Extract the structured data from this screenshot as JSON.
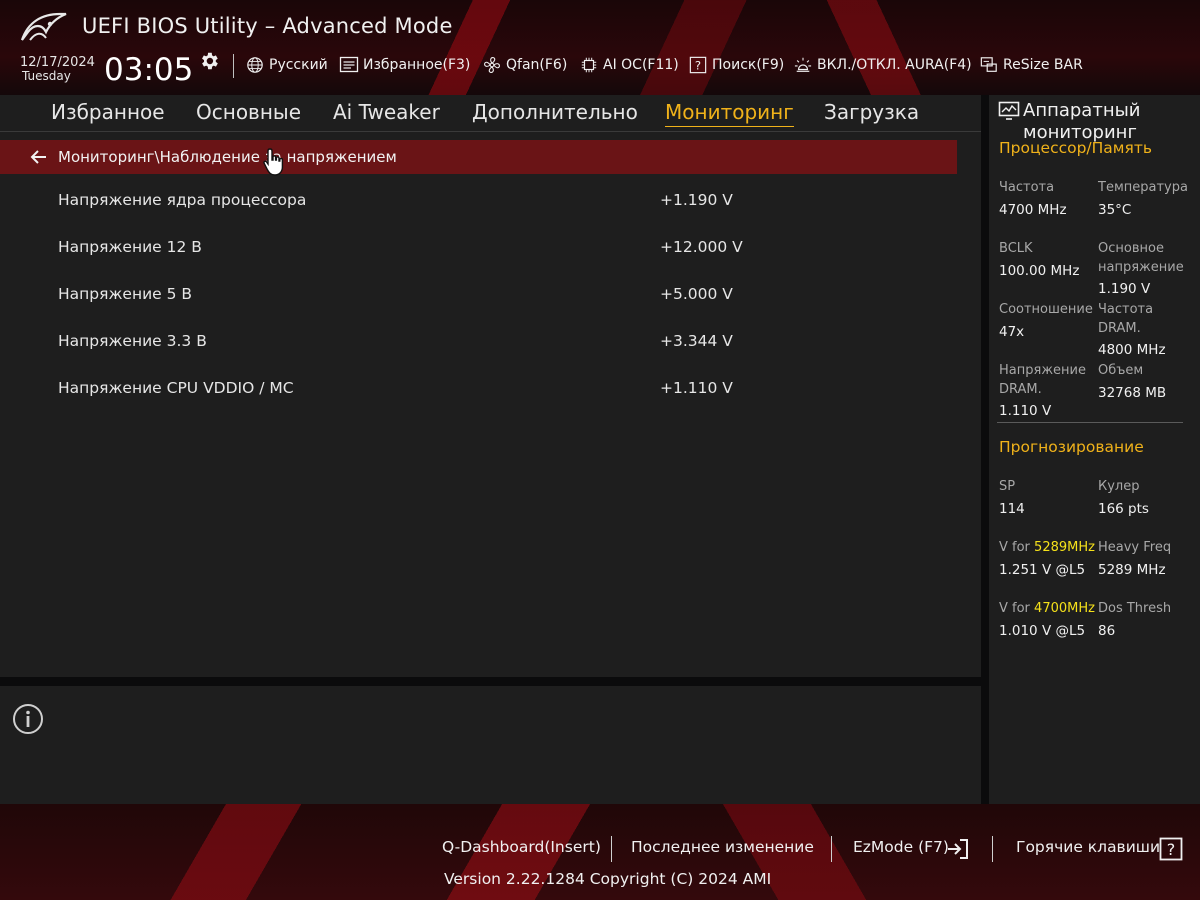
{
  "header": {
    "title": "UEFI BIOS Utility – Advanced Mode",
    "date": "12/17/2024",
    "weekday": "Tuesday",
    "time": "03:05",
    "tools": {
      "language": "Русский",
      "favorites": "Избранное(F3)",
      "qfan": "Qfan(F6)",
      "aioc": "AI OC(F11)",
      "search": "Поиск(F9)",
      "aura": "ВКЛ./ОТКЛ. AURA(F4)",
      "resizebar": "ReSize BAR"
    }
  },
  "tabs": {
    "favorites": "Избранное",
    "main": "Основные",
    "ai_tweaker": "Ai Tweaker",
    "advanced": "Дополнительно",
    "monitor": "Мониторинг",
    "boot": "Загрузка"
  },
  "breadcrumb": "Мониторинг\\Наблюдение за напряжением",
  "voltages": [
    {
      "label": "Напряжение ядра процессора",
      "value": "+1.190 V"
    },
    {
      "label": "Напряжение 12 В",
      "value": "+12.000 V"
    },
    {
      "label": "Напряжение 5 В",
      "value": "+5.000 V"
    },
    {
      "label": "Напряжение 3.3 В",
      "value": "+3.344 V"
    },
    {
      "label": "Напряжение CPU VDDIO / MC",
      "value": "+1.110 V"
    }
  ],
  "hw_monitor": {
    "title": "Аппаратный мониторинг",
    "cpu_mem": {
      "heading": "Процессор/Память",
      "frequency_label": "Частота",
      "frequency_value": "4700 MHz",
      "temperature_label": "Температура",
      "temperature_value": "35°C",
      "bclk_label": "BCLK",
      "bclk_value": "100.00 MHz",
      "core_voltage_label": "Основное напряжение",
      "core_voltage_value": "1.190 V",
      "ratio_label": "Соотношение",
      "ratio_value": "47x",
      "dram_freq_label": "Частота DRAM.",
      "dram_freq_value": "4800 MHz",
      "dram_voltage_label": "Напряжение DRAM.",
      "dram_voltage_value": "1.110 V",
      "capacity_label": "Объем",
      "capacity_value": "32768 MB"
    },
    "prediction": {
      "heading": "Прогнозирование",
      "sp_label": "SP",
      "sp_value": "114",
      "cooler_label": "Кулер",
      "cooler_value": "166 pts",
      "v_for_label": "V for",
      "v1_freq": "5289MHz",
      "v1_value": "1.251 V @L5",
      "heavy_freq_label": "Heavy Freq",
      "heavy_freq_value": "5289 MHz",
      "v2_freq": "4700MHz",
      "v2_value": "1.010 V @L5",
      "dos_thresh_label": "Dos Thresh",
      "dos_thresh_value": "86"
    }
  },
  "footer": {
    "qdashboard": "Q-Dashboard(Insert)",
    "last_modified": "Последнее изменение",
    "ezmode": "EzMode (F7)",
    "hotkeys": "Горячие клавиши",
    "version": "Version 2.22.1284 Copyright (C) 2024 AMI"
  },
  "colors": {
    "accent": "#f0b21a",
    "highlight": "#f5e11a",
    "selection": "#6a1416"
  }
}
